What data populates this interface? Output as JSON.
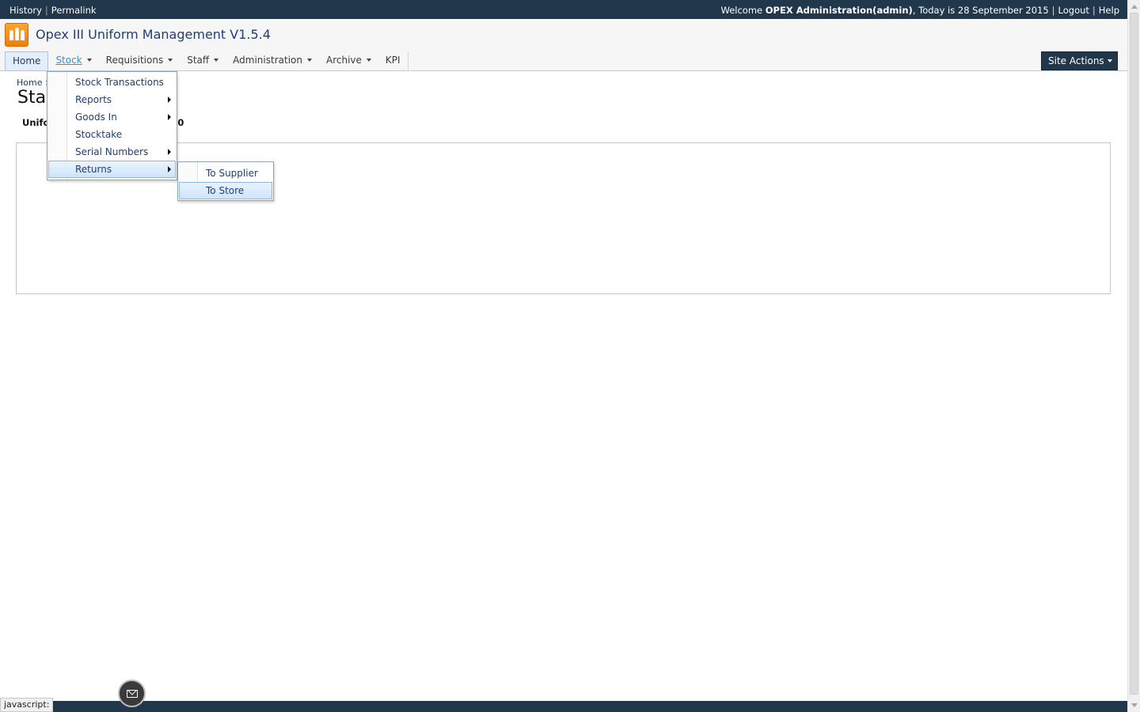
{
  "topbar": {
    "history": "History",
    "permalink": "Permalink",
    "welcome_prefix": "Welcome ",
    "user": "OPEX Administration(admin)",
    "today": ", Today is 28 September 2015",
    "logout": "Logout",
    "help": "Help"
  },
  "header": {
    "title": "Opex III Uniform Management V1.5.4",
    "logo_icon": "people-logo-icon",
    "accent_color": "#f28a12",
    "nav": [
      {
        "label": "Home"
      },
      {
        "label": "Stock"
      },
      {
        "label": "Requisitions"
      },
      {
        "label": "Staff"
      },
      {
        "label": "Administration"
      },
      {
        "label": "Archive"
      },
      {
        "label": "KPI"
      }
    ],
    "site_actions": "Site Actions"
  },
  "content": {
    "breadcrumb": "Home >",
    "page_title": "Sta",
    "subtitle_left": "Unifo",
    "subtitle_right": "0"
  },
  "stock_menu": [
    {
      "label": "Stock Transactions",
      "submenu": false
    },
    {
      "label": "Reports",
      "submenu": true
    },
    {
      "label": "Goods In",
      "submenu": true
    },
    {
      "label": "Stocktake",
      "submenu": false
    },
    {
      "label": "Serial Numbers",
      "submenu": true
    },
    {
      "label": "Returns",
      "submenu": true
    }
  ],
  "returns_menu": [
    {
      "label": "To Supplier"
    },
    {
      "label": "To Store"
    }
  ],
  "status": {
    "text": "javascript:",
    "mail_icon": "envelope-icon"
  },
  "colors": {
    "top_bar": "#21374c",
    "link": "#1f3f72",
    "highlight": "#cfe4fa"
  }
}
